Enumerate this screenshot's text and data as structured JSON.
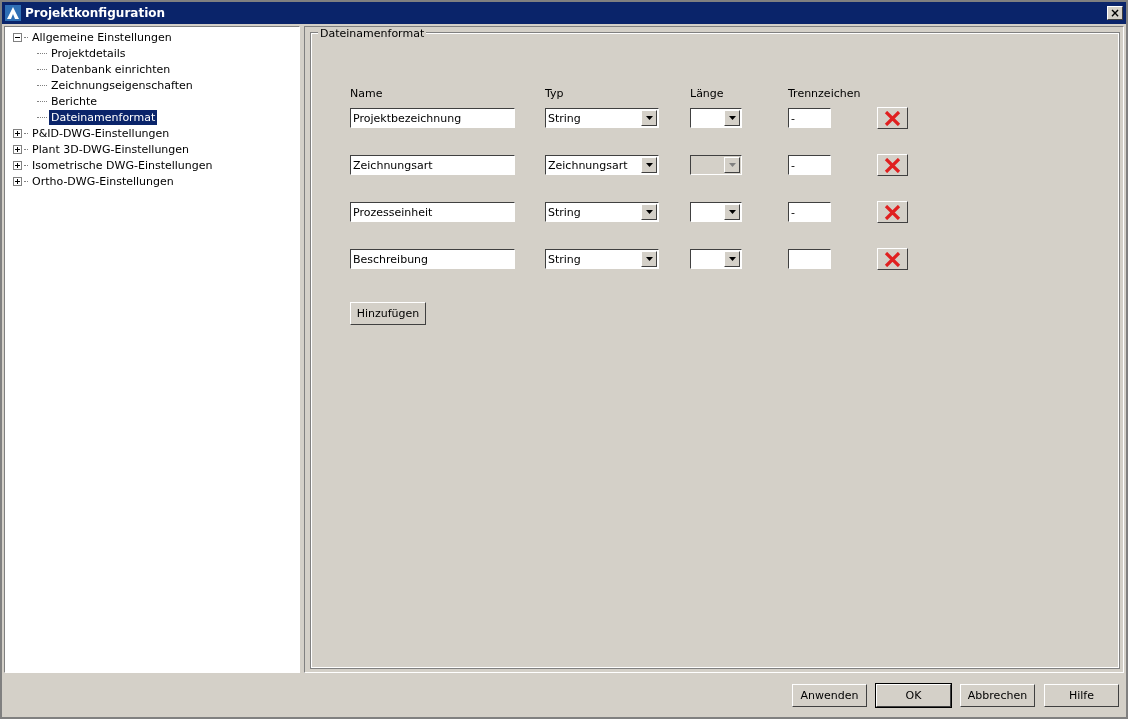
{
  "window": {
    "title": "Projektkonfiguration",
    "close": "×"
  },
  "tree": [
    {
      "label": "Allgemeine Einstellungen",
      "expanded": true,
      "selected": false,
      "children": [
        {
          "label": "Projektdetails",
          "selected": false
        },
        {
          "label": "Datenbank einrichten",
          "selected": false
        },
        {
          "label": "Zeichnungseigenschaften",
          "selected": false
        },
        {
          "label": "Berichte",
          "selected": false
        },
        {
          "label": "Dateinamenformat",
          "selected": true
        }
      ]
    },
    {
      "label": "P&ID-DWG-Einstellungen",
      "expanded": false,
      "selected": false
    },
    {
      "label": "Plant 3D-DWG-Einstellungen",
      "expanded": false,
      "selected": false
    },
    {
      "label": "Isometrische DWG-Einstellungen",
      "expanded": false,
      "selected": false
    },
    {
      "label": "Ortho-DWG-Einstellungen",
      "expanded": false,
      "selected": false
    }
  ],
  "group": {
    "title": "Dateinamenformat",
    "columns": [
      "Name",
      "Typ",
      "Länge",
      "Trennzeichen"
    ],
    "rows": [
      {
        "name": "Projektbezeichnung",
        "type": "String",
        "length_disabled": false,
        "separator": "-"
      },
      {
        "name": "Zeichnungsart",
        "type": "Zeichnungsart",
        "length_disabled": true,
        "separator": "-"
      },
      {
        "name": "Prozesseinheit",
        "type": "String",
        "length_disabled": false,
        "separator": "-"
      },
      {
        "name": "Beschreibung",
        "type": "String",
        "length_disabled": false
      }
    ],
    "add_button": "Hinzufügen"
  },
  "buttons": [
    {
      "label": "Anwenden",
      "default": false
    },
    {
      "label": "OK",
      "default": true
    },
    {
      "label": "Abbrechen",
      "default": false
    },
    {
      "label": "Hilfe",
      "default": false
    }
  ]
}
